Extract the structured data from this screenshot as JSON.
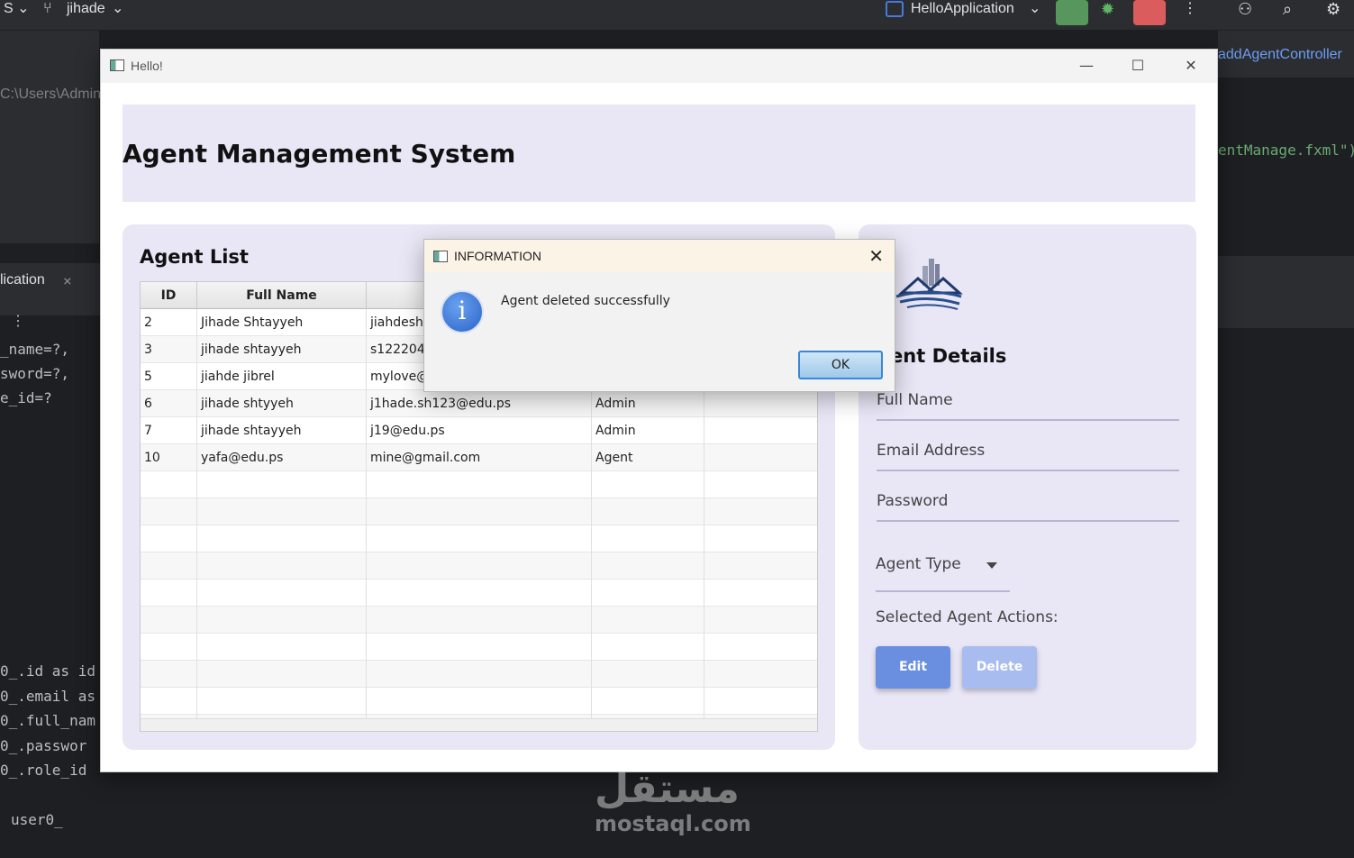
{
  "ide": {
    "branch": "jihade",
    "run_config": "HelloApplication",
    "path_fragment": "C:\\Users\\Admin",
    "tab_fragment": "lication",
    "right_tab": "addAgentController",
    "right_code": "entManage.fxml\")",
    "code_lines": [
      "_name=?,",
      "sword=?,",
      "e_id=?",
      "0_.id as id",
      "0_.email as",
      "0_.full_nam",
      "0_.passwor",
      "0_.role_id",
      "user0_"
    ]
  },
  "window": {
    "title": "Hello!"
  },
  "header": {
    "title": "Agent Management System"
  },
  "agent_list": {
    "title": "Agent List",
    "columns": [
      "ID",
      "Full Name",
      "",
      "",
      ""
    ],
    "rows": [
      {
        "id": "2",
        "name": "Jihade Shtayyeh",
        "email": "jiahdesh1",
        "role": ""
      },
      {
        "id": "3",
        "name": "jihade shtayyeh",
        "email": "s1222044",
        "role": ""
      },
      {
        "id": "5",
        "name": "jiahde jibrel",
        "email": "mylove@",
        "role": ""
      },
      {
        "id": "6",
        "name": "jihade shtyyeh",
        "email": "j1hade.sh123@edu.ps",
        "role": "Admin"
      },
      {
        "id": "7",
        "name": "jihade shtayyeh",
        "email": "j19@edu.ps",
        "role": "Admin"
      },
      {
        "id": "10",
        "name": "yafa@edu.ps",
        "email": "mine@gmail.com",
        "role": "Agent"
      }
    ]
  },
  "details": {
    "title": "gent Details",
    "full_name_placeholder": "Full Name",
    "email_placeholder": "Email Address",
    "password_placeholder": "Password",
    "agent_type": "Agent Type",
    "actions_label": "Selected Agent Actions:",
    "edit_label": "Edit",
    "delete_label": "Delete"
  },
  "dialog": {
    "title": "INFORMATION",
    "message": "Agent deleted successfully",
    "ok_label": "OK",
    "icon_glyph": "i"
  },
  "watermark": {
    "arabic": "مستقل",
    "latin": "mostaql.com"
  }
}
